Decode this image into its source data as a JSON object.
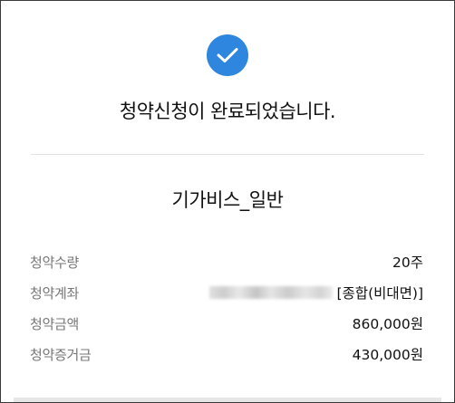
{
  "status": {
    "icon": "check-icon",
    "accent_color": "#2e86de",
    "message": "청약신청이 완료되었습니다."
  },
  "product": {
    "name": "기가비스_일반"
  },
  "details": [
    {
      "label": "청약수량",
      "value": "20주"
    },
    {
      "label": "청약계좌",
      "value": "[종합(비대면)]"
    },
    {
      "label": "청약금액",
      "value": "860,000원"
    },
    {
      "label": "청약증거금",
      "value": "430,000원"
    }
  ]
}
